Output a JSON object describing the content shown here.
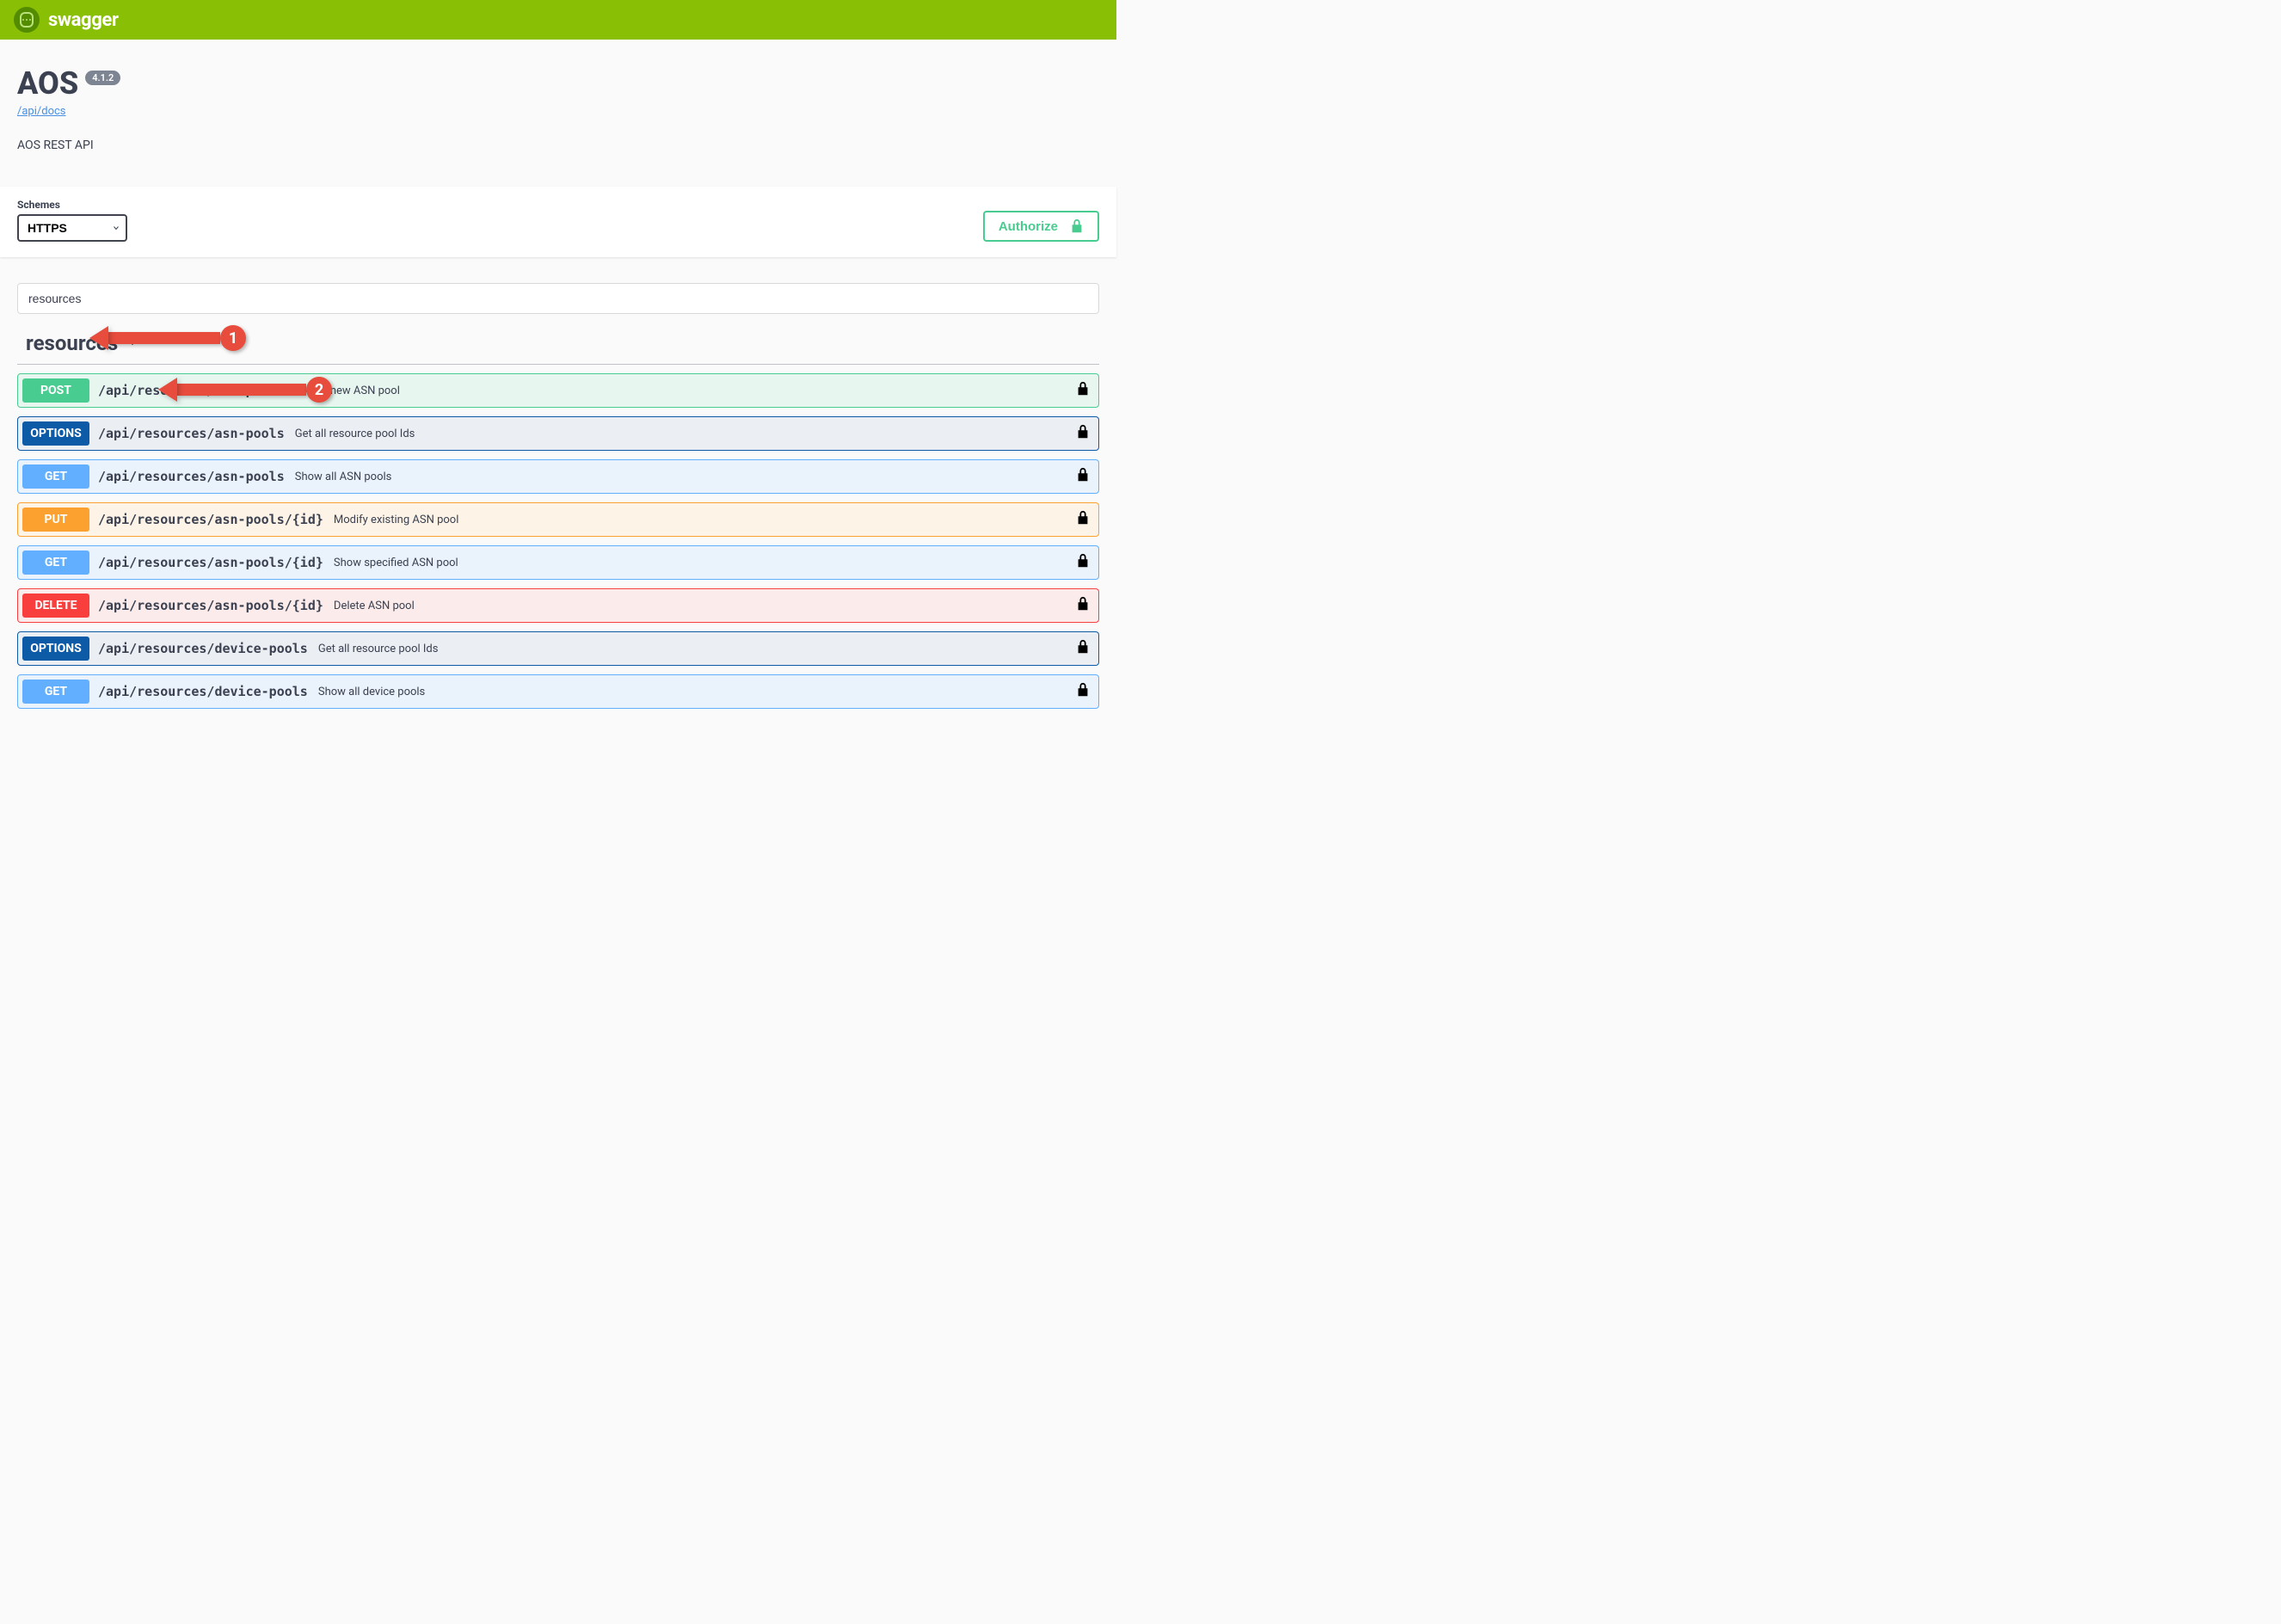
{
  "topbar": {
    "brand": "swagger"
  },
  "info": {
    "title": "AOS",
    "version": "4.1.2",
    "base_url_label": "/api/docs",
    "description": "AOS REST API"
  },
  "schemes": {
    "label": "Schemes",
    "selected": "HTTPS"
  },
  "authorize": {
    "label": "Authorize"
  },
  "filter": {
    "value": "resources"
  },
  "tag": {
    "name": "resources"
  },
  "callouts": [
    {
      "num": "1"
    },
    {
      "num": "2"
    }
  ],
  "operations": [
    {
      "method": "POST",
      "css": "post",
      "path": "/api/resources/asn-pools",
      "summary": "Create new ASN pool"
    },
    {
      "method": "OPTIONS",
      "css": "options",
      "path": "/api/resources/asn-pools",
      "summary": "Get all resource pool Ids"
    },
    {
      "method": "GET",
      "css": "get",
      "path": "/api/resources/asn-pools",
      "summary": "Show all ASN pools"
    },
    {
      "method": "PUT",
      "css": "put",
      "path": "/api/resources/asn-pools/{id}",
      "summary": "Modify existing ASN pool"
    },
    {
      "method": "GET",
      "css": "get",
      "path": "/api/resources/asn-pools/{id}",
      "summary": "Show specified ASN pool"
    },
    {
      "method": "DELETE",
      "css": "delete",
      "path": "/api/resources/asn-pools/{id}",
      "summary": "Delete ASN pool"
    },
    {
      "method": "OPTIONS",
      "css": "options",
      "path": "/api/resources/device-pools",
      "summary": "Get all resource pool Ids"
    },
    {
      "method": "GET",
      "css": "get",
      "path": "/api/resources/device-pools",
      "summary": "Show all device pools"
    }
  ]
}
